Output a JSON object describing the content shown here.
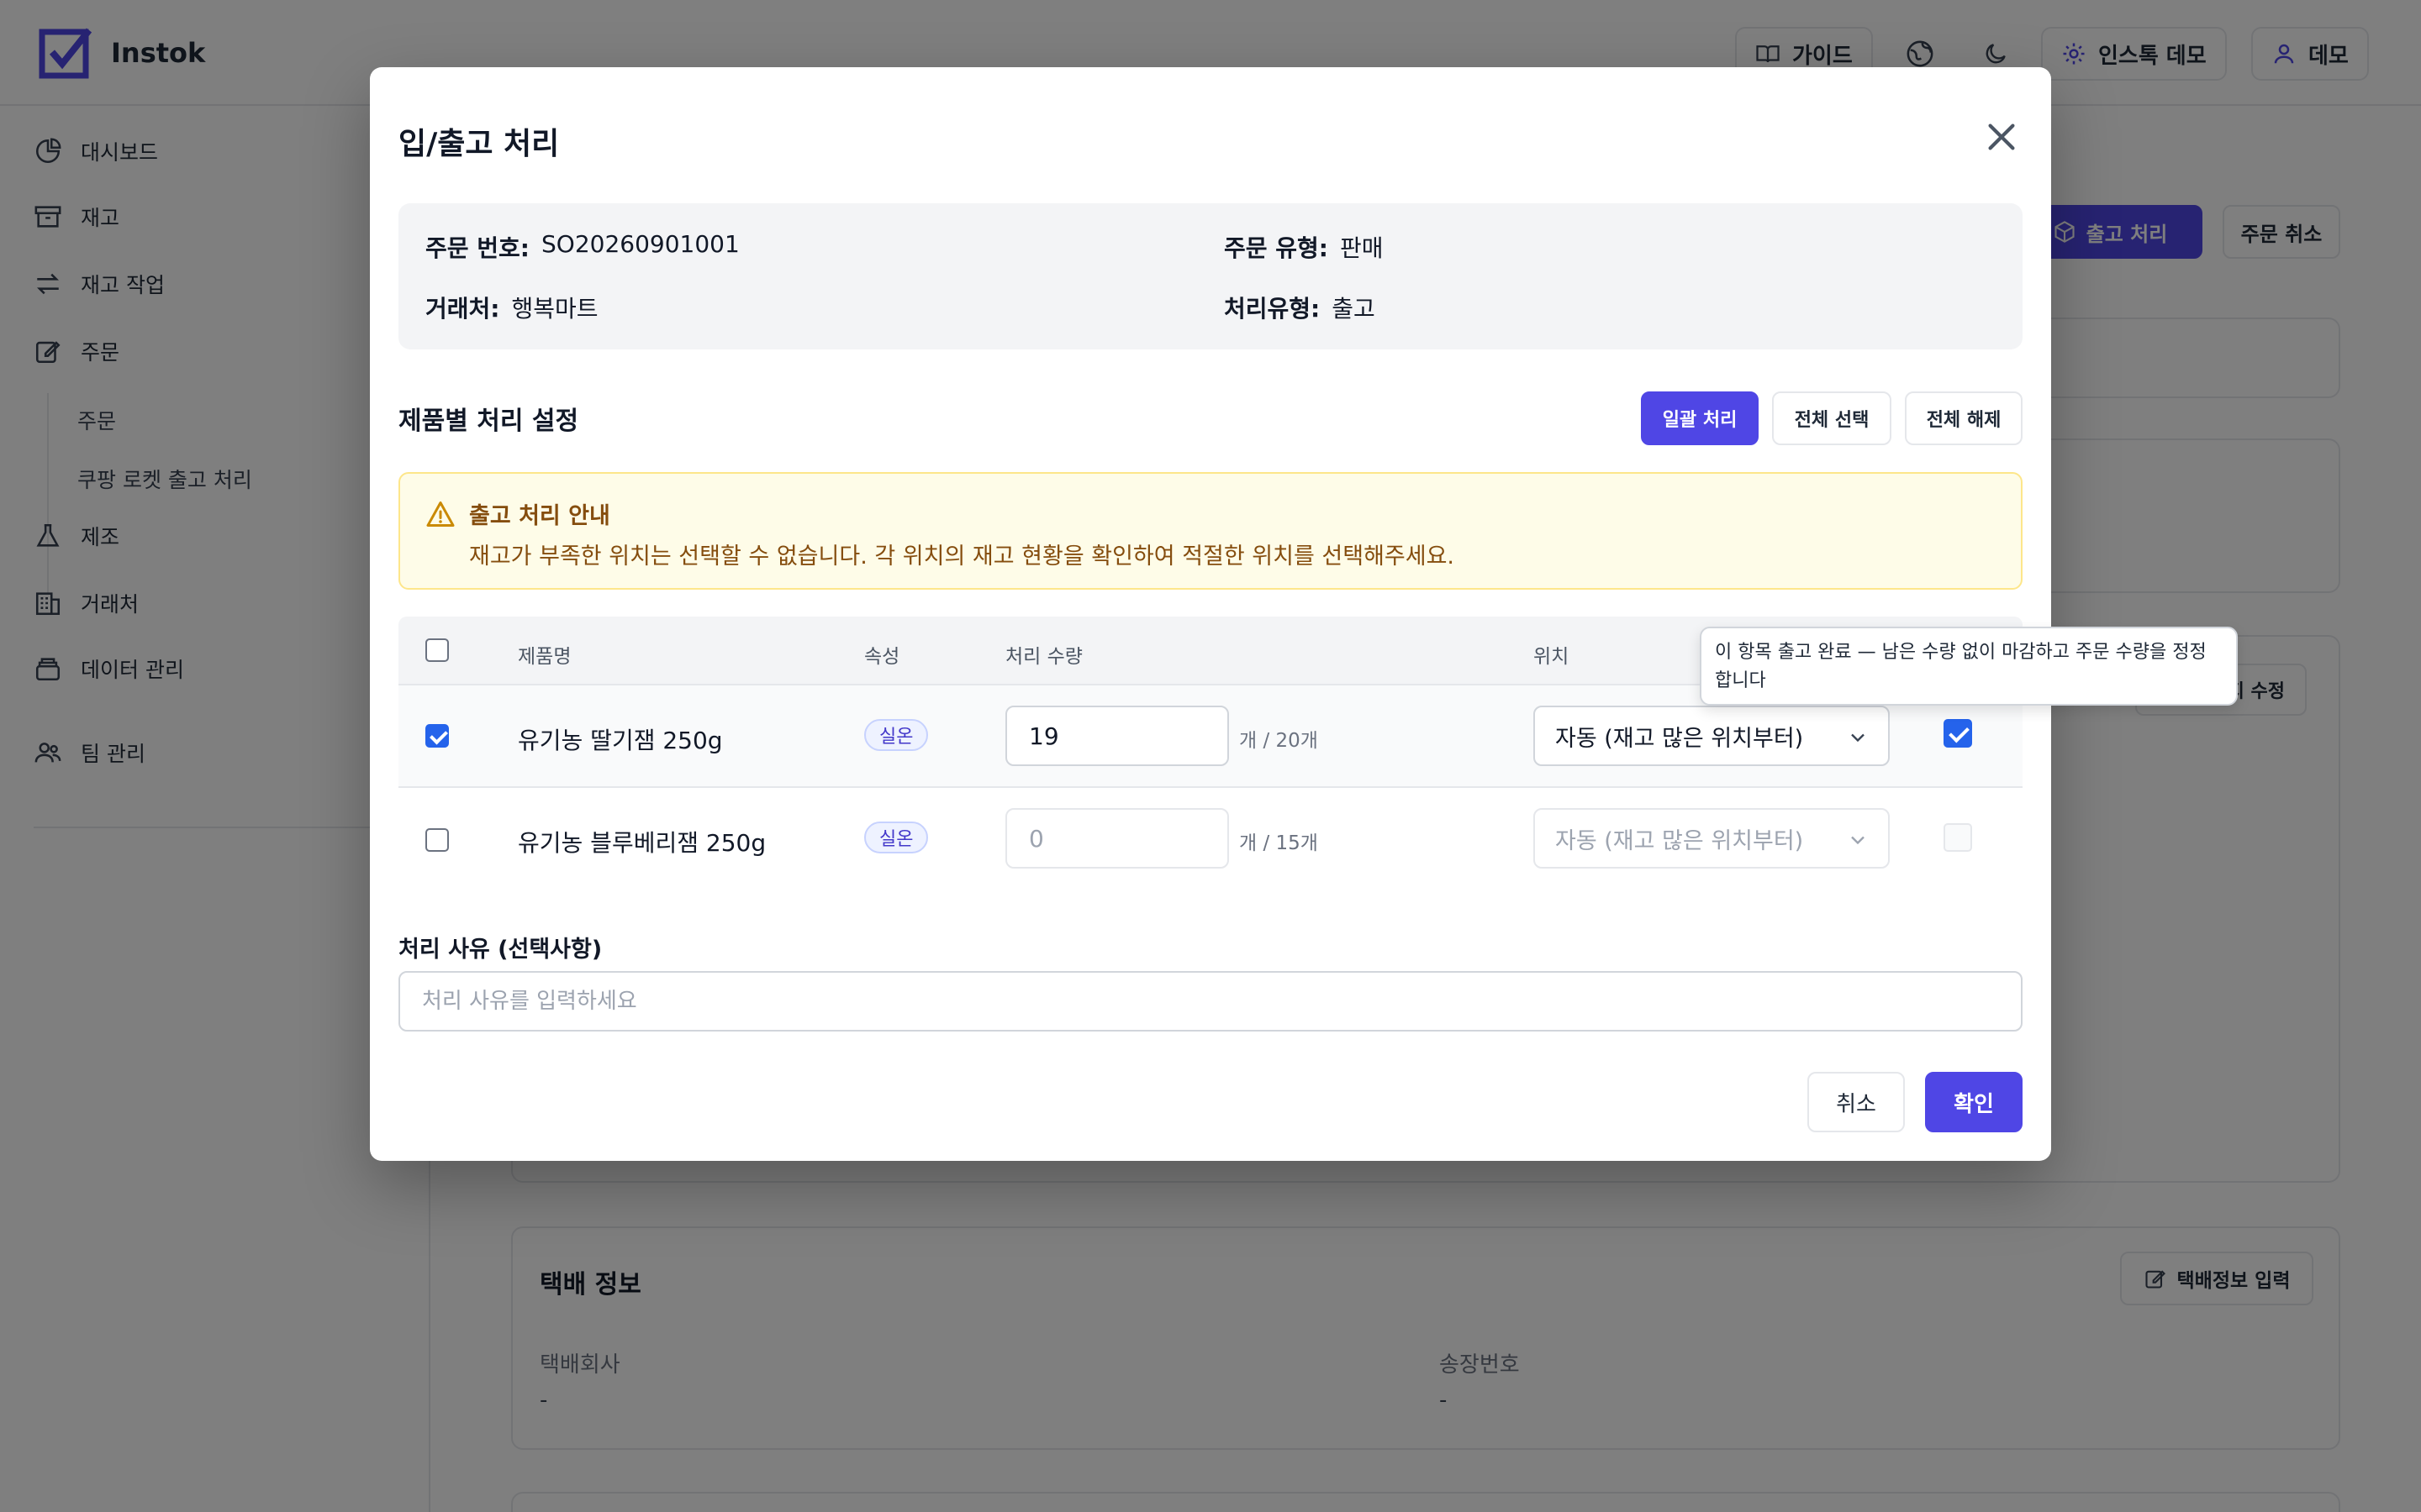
{
  "app": {
    "name": "Instok"
  },
  "header": {
    "guide_label": "가이드",
    "settings_label": "인스톡 데모",
    "user_label": "데모"
  },
  "sidebar": {
    "items": [
      {
        "label": "대시보드",
        "icon": "pie-chart-icon"
      },
      {
        "label": "재고",
        "icon": "archive-icon"
      },
      {
        "label": "재고 작업",
        "icon": "arrows-swap-icon"
      },
      {
        "label": "주문",
        "icon": "edit-note-icon"
      },
      {
        "label": "제조",
        "icon": "flask-icon"
      },
      {
        "label": "거래처",
        "icon": "building-icon"
      },
      {
        "label": "데이터 관리",
        "icon": "database-icon"
      },
      {
        "label": "팀 관리",
        "icon": "team-icon"
      }
    ],
    "sub_items": [
      "주문",
      "쿠팡 로켓 출고 처리"
    ]
  },
  "background": {
    "outbound_button": "출고 처리",
    "cancel_order_button": "주문 취소",
    "edit_button_partial": "지 수정",
    "shipping_title": "택배 정보",
    "shipping_input_button": "택배정보 입력",
    "carrier_label": "택배회사",
    "carrier_value": "-",
    "tracking_label": "송장번호",
    "tracking_value": "-"
  },
  "modal": {
    "title": "입/출고 처리",
    "order": {
      "number_label": "주문 번호:",
      "number_value": "SO20260901001",
      "type_label": "주문 유형:",
      "type_value": "판매",
      "partner_label": "거래처:",
      "partner_value": "행복마트",
      "process_type_label": "처리유형:",
      "process_type_value": "출고"
    },
    "section_title": "제품별 처리 설정",
    "bulk_button": "일괄 처리",
    "select_all_button": "전체 선택",
    "deselect_all_button": "전체 해제",
    "notice": {
      "title": "출고 처리 안내",
      "message": "재고가 부족한 위치는 선택할 수 없습니다. 각 위치의 재고 현황을 확인하여 적절한 위치를 선택해주세요."
    },
    "table": {
      "headers": {
        "product": "제품명",
        "attribute": "속성",
        "quantity": "처리 수량",
        "location": "위치"
      },
      "rows": [
        {
          "selected": true,
          "product": "유기농 딸기잼 250g",
          "attribute": "실온",
          "quantity": "19",
          "unit": "개 / 20개",
          "location": "자동 (재고 많은 위치부터)",
          "complete": true
        },
        {
          "selected": false,
          "product": "유기농 블루베리잼 250g",
          "attribute": "실온",
          "quantity": "0",
          "unit": "개 / 15개",
          "location": "자동 (재고 많은 위치부터)",
          "complete": false
        }
      ]
    },
    "tooltip": "이 항목 출고 완료 — 남은 수량 없이 마감하고 주문 수량을 정정합니다",
    "reason_label": "처리 사유 (선택사항)",
    "reason_placeholder": "처리 사유를 입력하세요",
    "cancel_button": "취소",
    "confirm_button": "확인"
  },
  "colors": {
    "primary": "#4f46e5",
    "notice_bg": "#fefce8",
    "notice_text": "#854d0e"
  }
}
